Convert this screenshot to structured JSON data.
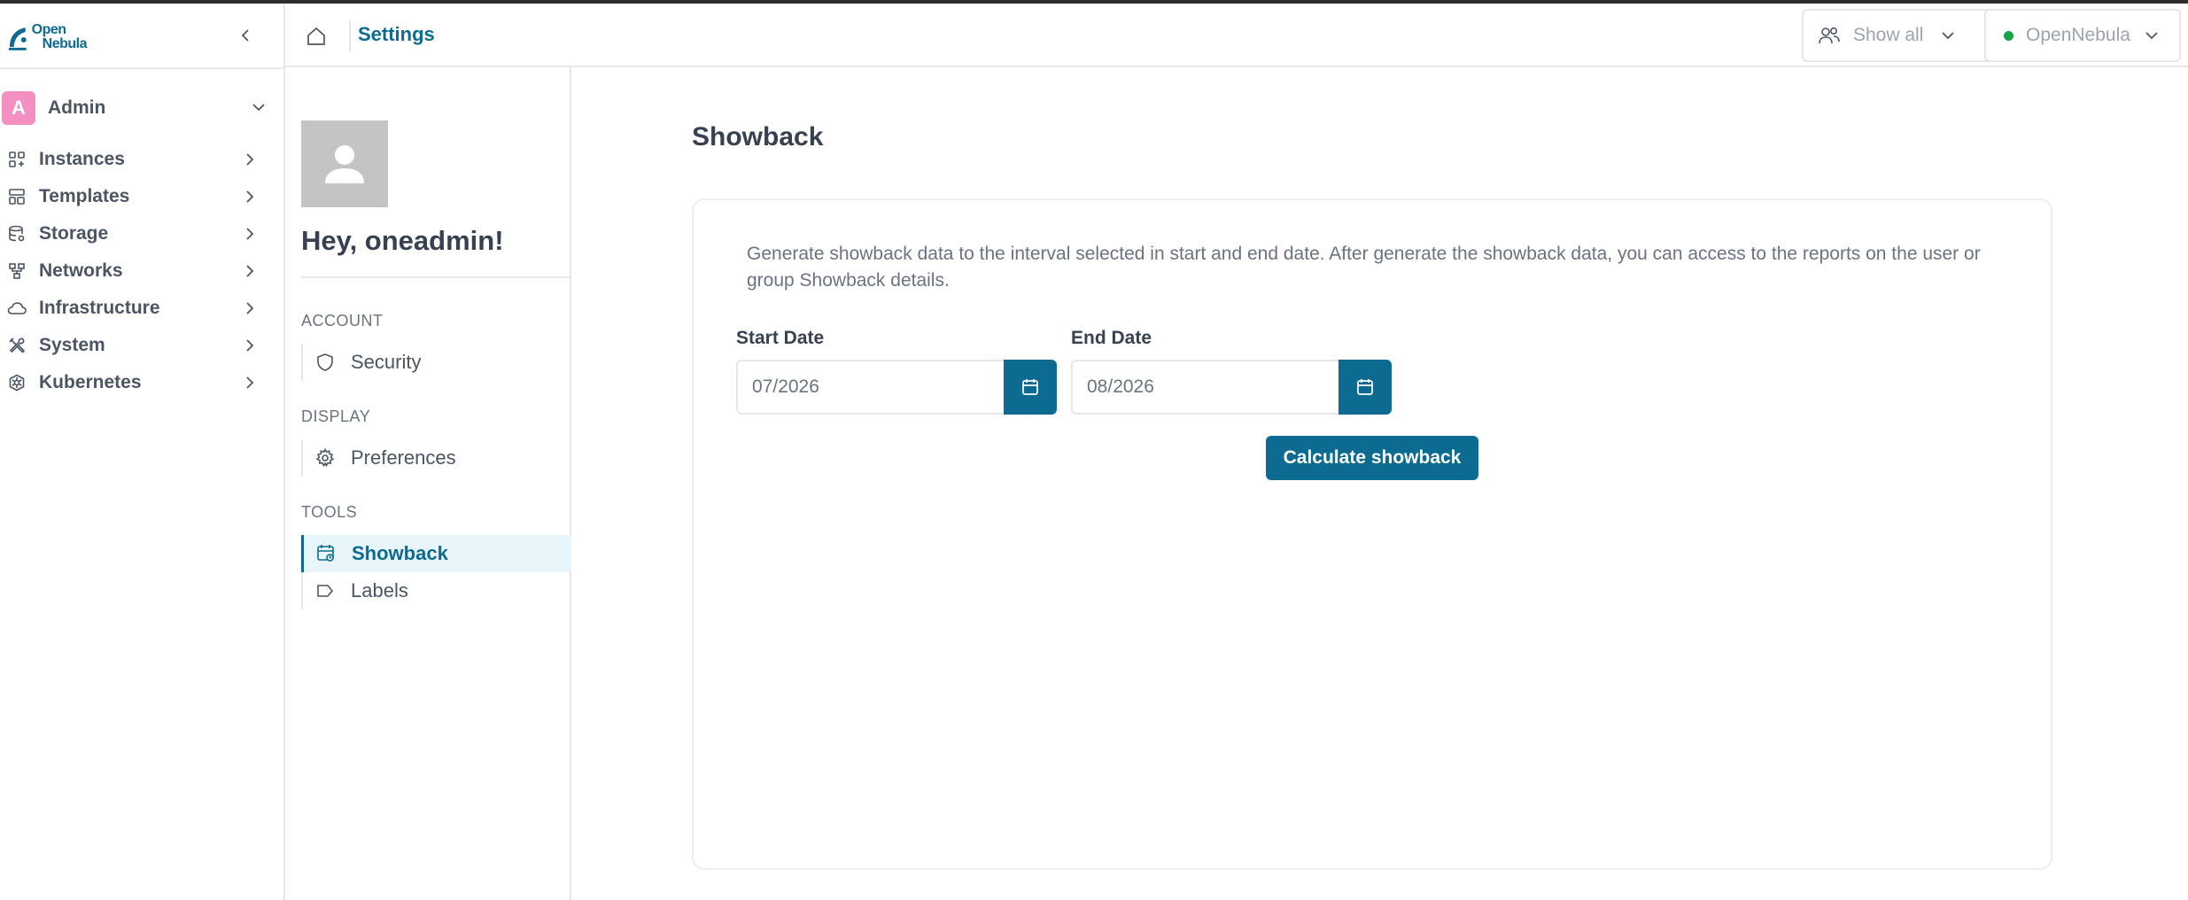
{
  "app": {
    "logo_line1": "Open",
    "logo_line2": "Nebula"
  },
  "sidebar": {
    "user": {
      "initial": "A",
      "name": "Admin"
    },
    "items": [
      {
        "label": "Instances",
        "icon": "instances-icon"
      },
      {
        "label": "Templates",
        "icon": "templates-icon"
      },
      {
        "label": "Storage",
        "icon": "storage-icon"
      },
      {
        "label": "Networks",
        "icon": "networks-icon"
      },
      {
        "label": "Infrastructure",
        "icon": "cloud-icon"
      },
      {
        "label": "System",
        "icon": "tools-icon"
      },
      {
        "label": "Kubernetes",
        "icon": "kubernetes-icon"
      }
    ]
  },
  "topbar": {
    "breadcrumb": "Settings",
    "group_filter": "Show all",
    "zone": "OpenNebula"
  },
  "settings_nav": {
    "greeting": "Hey, oneadmin!",
    "sections": [
      {
        "title": "ACCOUNT",
        "items": [
          {
            "label": "Security",
            "icon": "shield-icon"
          }
        ]
      },
      {
        "title": "DISPLAY",
        "items": [
          {
            "label": "Preferences",
            "icon": "gear-icon"
          }
        ]
      },
      {
        "title": "TOOLS",
        "items": [
          {
            "label": "Showback",
            "icon": "calendar-chart-icon",
            "active": true
          },
          {
            "label": "Labels",
            "icon": "label-icon"
          }
        ]
      }
    ]
  },
  "main": {
    "title": "Showback",
    "description": "Generate showback data to the interval selected in start and end date. After generate the showback data, you can access to the reports on the user or group Showback details.",
    "start_date": {
      "label": "Start Date",
      "value": "07/2026"
    },
    "end_date": {
      "label": "End Date",
      "value": "08/2026"
    },
    "calculate_label": "Calculate showback"
  },
  "colors": {
    "accent": "#0d6b91",
    "avatar": "#f48fc1",
    "status_ok": "#16a34a"
  }
}
